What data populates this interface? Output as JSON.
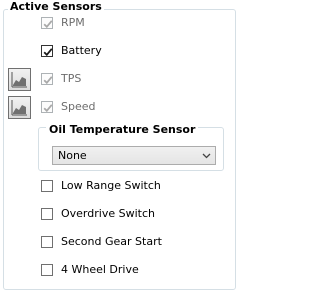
{
  "group": {
    "title": "Active Sensors"
  },
  "sensors": [
    {
      "label": "RPM",
      "checked": true,
      "enabled": false
    },
    {
      "label": "Battery",
      "checked": true,
      "enabled": true
    },
    {
      "label": "TPS",
      "checked": true,
      "enabled": false
    },
    {
      "label": "Speed",
      "checked": true,
      "enabled": false
    }
  ],
  "chart_buttons": [
    {
      "for": "TPS",
      "icon": "chart-icon"
    },
    {
      "for": "Speed",
      "icon": "chart-icon"
    }
  ],
  "oil_temp": {
    "title": "Oil Temperature Sensor",
    "selected": "None"
  },
  "switches": [
    {
      "label": "Low Range Switch",
      "checked": false
    },
    {
      "label": "Overdrive Switch",
      "checked": false
    },
    {
      "label": "Second Gear Start",
      "checked": false
    },
    {
      "label": "4 Wheel Drive",
      "checked": false
    }
  ],
  "colors": {
    "border": "#d5dfe5",
    "disabled_text": "#6d6d6d",
    "disabled_border": "#adb2b5"
  }
}
